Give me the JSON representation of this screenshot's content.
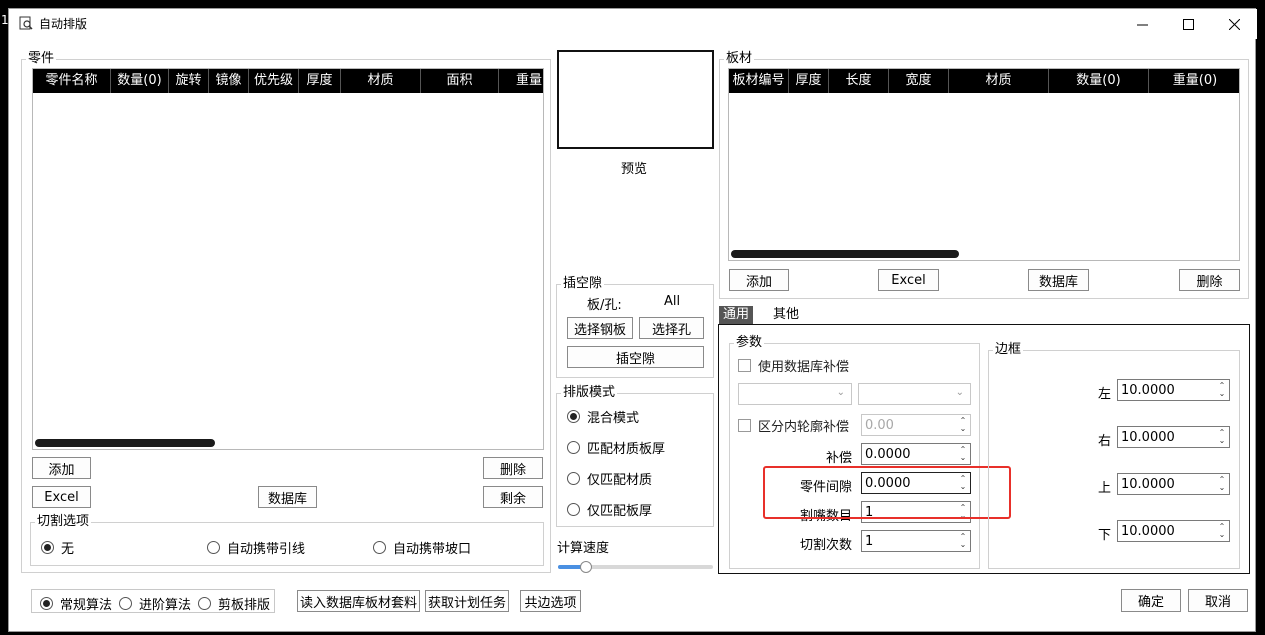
{
  "window": {
    "title": "自动排版",
    "edge_char": "1"
  },
  "parts": {
    "group_label": "零件",
    "columns": [
      "零件名称",
      "数量(0)",
      "旋转",
      "镜像",
      "优先级",
      "厚度",
      "材质",
      "面积",
      "重量"
    ],
    "add_label": "添加",
    "delete_label": "删除",
    "excel_label": "Excel",
    "database_label": "数据库",
    "remain_label": "剩余"
  },
  "cut_options": {
    "group_label": "切割选项",
    "options": [
      "无",
      "自动携带引线",
      "自动携带坡口"
    ],
    "selected": 0
  },
  "preview": {
    "label": "预览"
  },
  "insert_gap": {
    "group_label": "插空隙",
    "board_hole_label": "板/孔:",
    "board_hole_value": "All",
    "select_plate_label": "选择钢板",
    "select_hole_label": "选择孔",
    "insert_label": "插空隙"
  },
  "layout_mode": {
    "group_label": "排版模式",
    "options": [
      "混合模式",
      "匹配材质板厚",
      "仅匹配材质",
      "仅匹配板厚"
    ],
    "selected": 0
  },
  "speed": {
    "label": "计算速度",
    "value": 0.18
  },
  "plates": {
    "group_label": "板材",
    "columns": [
      "板材编号",
      "厚度",
      "长度",
      "宽度",
      "材质",
      "数量(0)",
      "重量(0)"
    ],
    "add_label": "添加",
    "excel_label": "Excel",
    "database_label": "数据库",
    "delete_label": "删除"
  },
  "tabs": {
    "items": [
      "通用",
      "其他"
    ],
    "active": 0
  },
  "params": {
    "group_label": "参数",
    "use_db_comp_label": "使用数据库补偿",
    "distinguish_label": "区分内轮廓补偿",
    "distinguish_value": "0.00",
    "comp_label": "补偿",
    "comp_value": "0.0000",
    "gap_label": "零件间隙",
    "gap_value": "0.0000",
    "nozzle_label": "割嘴数目",
    "nozzle_value": "1",
    "cut_count_label": "切割次数",
    "cut_count_value": "1"
  },
  "border": {
    "group_label": "边框",
    "left_label": "左",
    "left_value": "10.0000",
    "right_label": "右",
    "right_value": "10.0000",
    "top_label": "上",
    "top_value": "10.0000",
    "bottom_label": "下",
    "bottom_value": "10.0000"
  },
  "footer": {
    "algorithms": [
      "常规算法",
      "进阶算法",
      "剪板排版"
    ],
    "algo_selected": 0,
    "read_db_label": "读入数据库板材套料",
    "get_plan_label": "获取计划任务",
    "common_edge_label": "共边选项",
    "ok_label": "确定",
    "cancel_label": "取消"
  }
}
